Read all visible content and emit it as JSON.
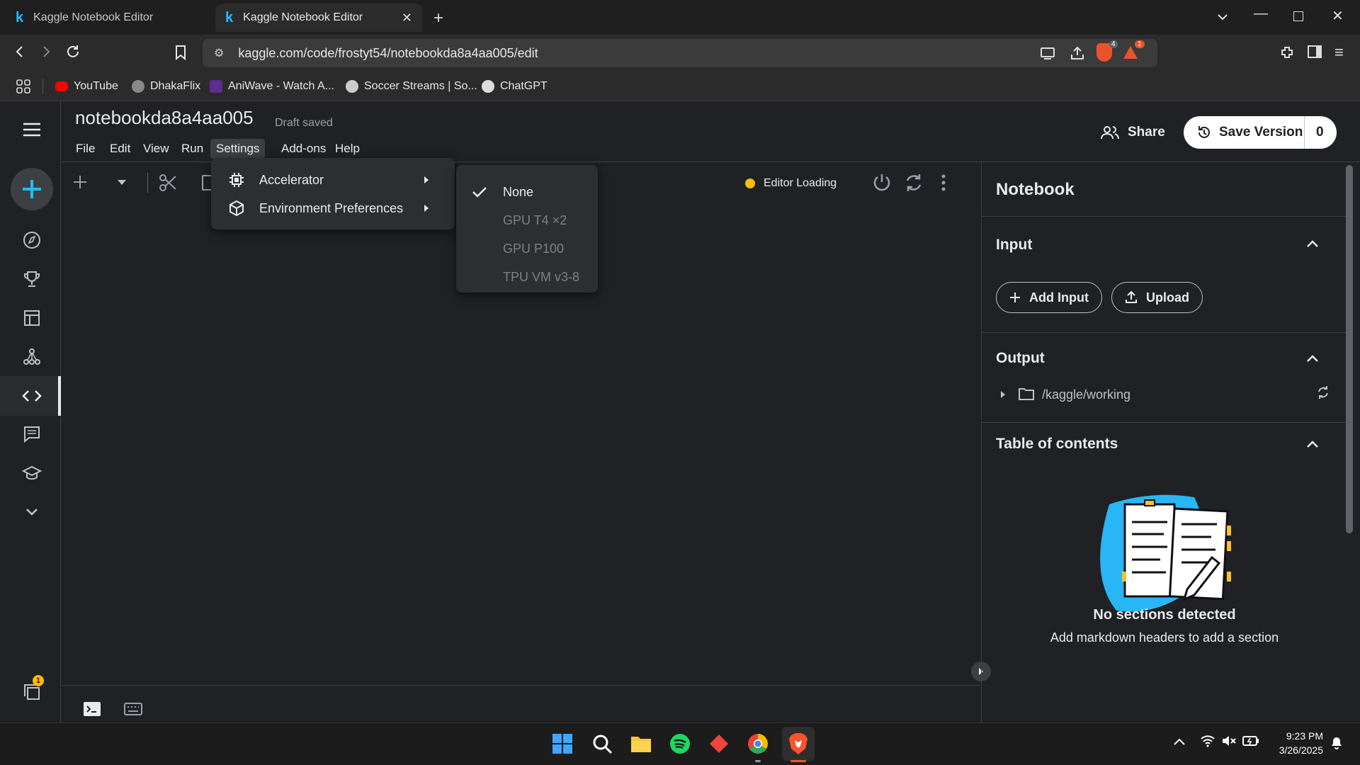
{
  "browser": {
    "tabs": [
      {
        "title": "Kaggle Notebook Editor",
        "active": false
      },
      {
        "title": "Kaggle Notebook Editor",
        "active": true
      }
    ],
    "url": "kaggle.com/code/frostyt54/notebookda8a4aa005/edit",
    "shield_badge": "4",
    "alert_badge": "1",
    "bookmarks": [
      "YouTube",
      "DhakaFlix",
      "AniWave - Watch A...",
      "Soccer Streams | So...",
      "ChatGPT"
    ]
  },
  "notebook": {
    "title": "notebookda8a4aa005",
    "save_status": "Draft saved",
    "menu": [
      "File",
      "Edit",
      "View",
      "Run",
      "Settings",
      "Add-ons",
      "Help"
    ],
    "share_label": "Share",
    "save_version_label": "Save Version",
    "save_version_count": "0",
    "status": "Editor Loading",
    "sidebar_badge": "1"
  },
  "settings_menu": {
    "items": [
      "Accelerator",
      "Environment Preferences"
    ]
  },
  "accelerator_menu": {
    "selected": "None",
    "options": [
      "None",
      "GPU T4 ×2",
      "GPU P100",
      "TPU VM v3-8"
    ]
  },
  "right_panel": {
    "title": "Notebook",
    "input_header": "Input",
    "add_input_label": "Add Input",
    "upload_label": "Upload",
    "output_header": "Output",
    "output_path": "/kaggle/working",
    "toc_header": "Table of contents",
    "empty_title": "No sections detected",
    "empty_subtitle": "Add markdown headers to add a section"
  },
  "taskbar": {
    "time": "9:23 PM",
    "date": "3/26/2025"
  },
  "colors": {
    "accent": "#20beff",
    "status_dot": "#fbbc04",
    "background": "#202124"
  }
}
